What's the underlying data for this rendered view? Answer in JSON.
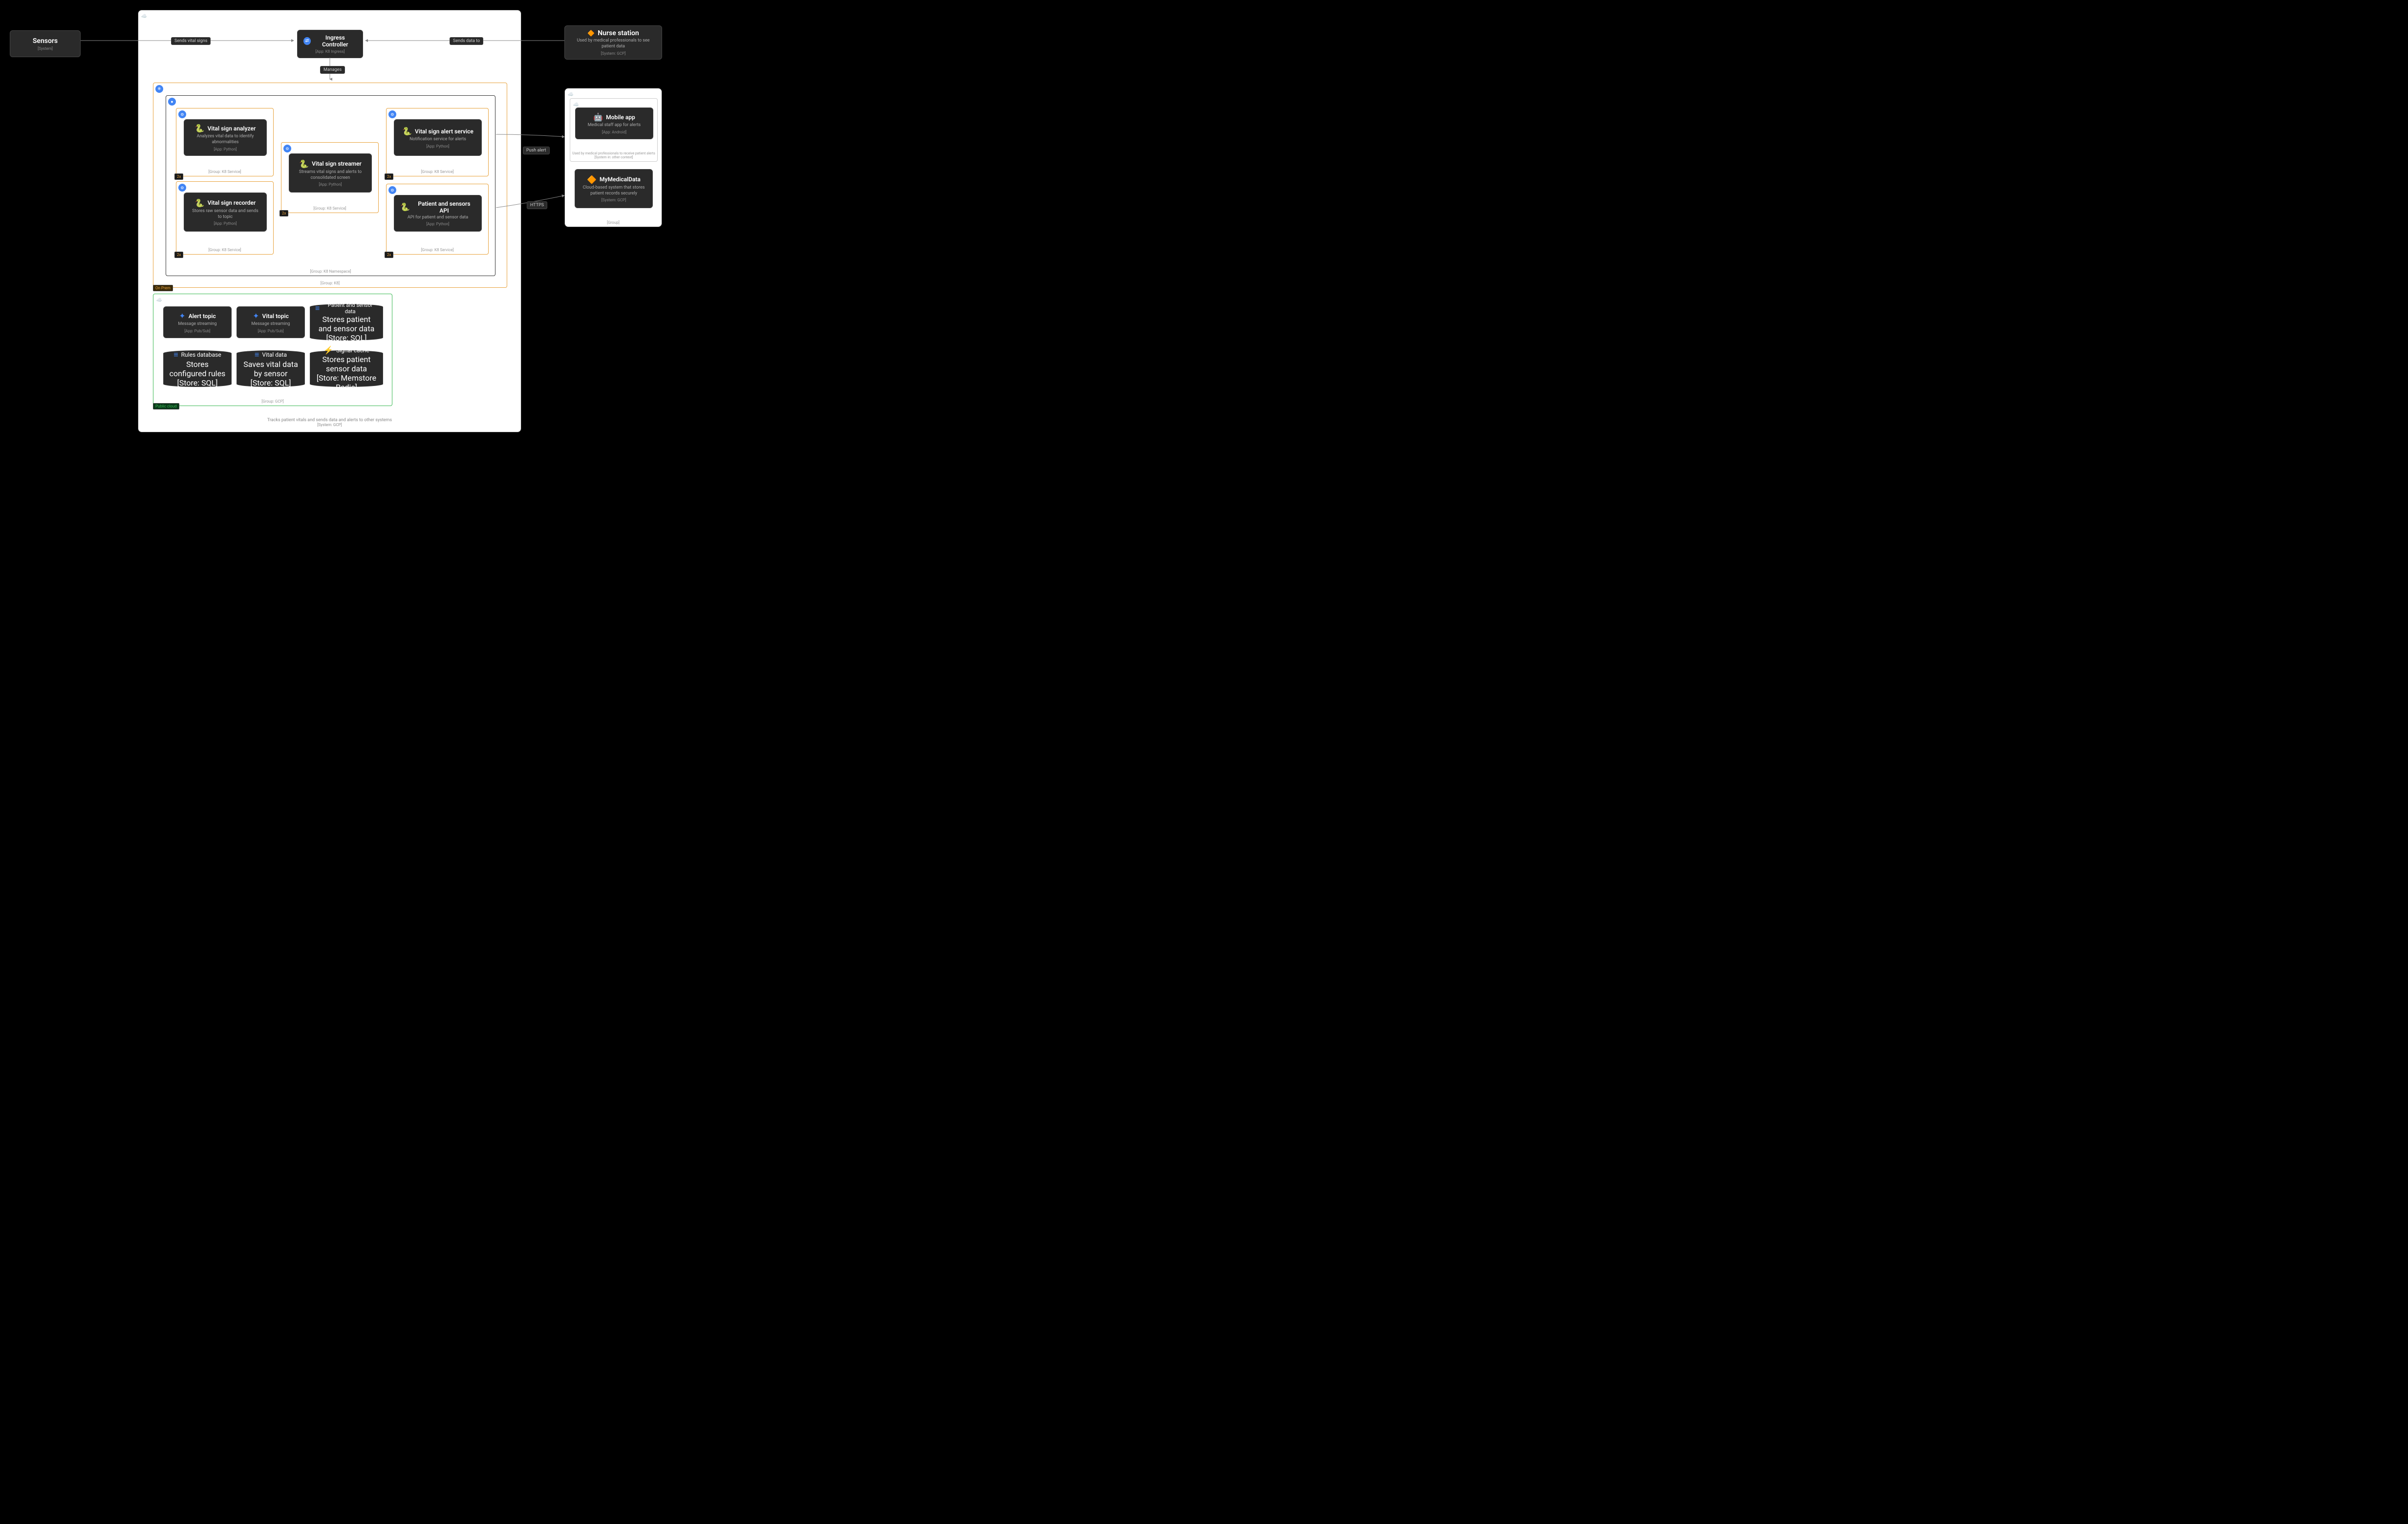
{
  "sensors": {
    "title": "Sensors",
    "meta": "[System]"
  },
  "nurse": {
    "title": "Nurse station",
    "desc": "Used by medical professionals to see patient data",
    "meta": "[System: GCP]"
  },
  "ingress": {
    "title": "Ingress Controller",
    "meta": "[App: K8 Ingress]"
  },
  "edges": {
    "sendsVitals": "Sends vital signs",
    "sendsData": "Sends data to",
    "manages": "Manages",
    "pushAlert": "Push alert",
    "https": "HTTPS"
  },
  "k8": {
    "label": "[Group: K8]",
    "onprem": "On Prem",
    "nsLabel": "[Group: K8 Namespace]",
    "serviceLabel": "[Group: K8 Service]",
    "x2": "2x",
    "analyzer": {
      "title": "Vital sign analyzer",
      "desc": "Analyzes vital data to identify abnormalities",
      "meta": "[App: Python]"
    },
    "recorder": {
      "title": "Vital sign recorder",
      "desc": "Stores raw sensor data and sends to topic",
      "meta": "[App: Python]"
    },
    "streamer": {
      "title": "Vital sign streamer",
      "desc": "Streams vital signs and alerts to consolidated screen",
      "meta": "[App: Python]"
    },
    "alertSvc": {
      "title": "Vital sign alert service",
      "desc": "Notification service for alerts",
      "meta": "[App: Python]"
    },
    "api": {
      "title": "Patient and sensors API",
      "desc": "API for patient and sensor data",
      "meta": "[App: Python]"
    }
  },
  "gcp": {
    "label": "[Group: GCP]",
    "public": "Public cloud",
    "alertTopic": {
      "title": "Alert topic",
      "desc": "Message streaming",
      "meta": "[App: Pub/Sub]"
    },
    "vitalTopic": {
      "title": "Vital topic",
      "desc": "Message streaming",
      "meta": "[App: Pub/Sub]"
    },
    "patientData": {
      "title": "Patient and sensor data",
      "desc": "Stores patient and sensor data",
      "meta": "[Store: SQL]"
    },
    "rulesDb": {
      "title": "Rules database",
      "desc": "Stores configured rules",
      "meta": "[Store: SQL]"
    },
    "vitalData": {
      "title": "Vital data",
      "desc": "Saves vital data by sensor",
      "meta": "[Store: SQL]"
    },
    "signalCache": {
      "title": "Signal cache",
      "desc": "Stores patient sensor data",
      "meta": "[Store: Memstore Redis]"
    }
  },
  "sysFooter": {
    "desc": "Tracks patient vitals and sends data and alerts to other systems",
    "meta": "[System: GCP]"
  },
  "ext": {
    "label": "[Group]",
    "mobile": {
      "title": "Mobile app",
      "desc": "Medical staff app for alerts",
      "meta": "[App: Android]"
    },
    "mobileCtx": {
      "desc": "Used by medical professionals to receive patient alerts",
      "meta": "[System in: other context]"
    },
    "mmd": {
      "title": "MyMedicalData",
      "desc": "Cloud-based system that stores patient records securely",
      "meta": "[System: GCP]"
    }
  }
}
